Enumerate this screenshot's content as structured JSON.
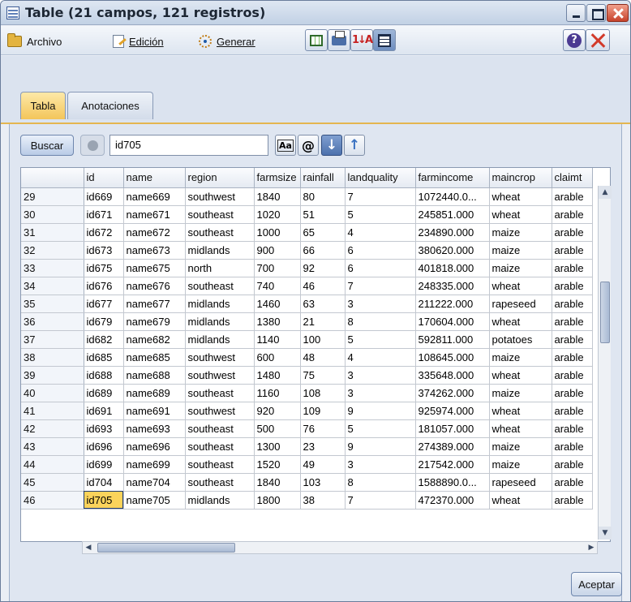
{
  "window": {
    "title": "Table (21 campos, 121 registros)"
  },
  "menu": {
    "file": "Archivo",
    "edit": "Edición",
    "generate": "Generar"
  },
  "tabs": [
    {
      "label": "Tabla",
      "active": true
    },
    {
      "label": "Anotaciones",
      "active": false
    }
  ],
  "search": {
    "button_label": "Buscar",
    "value": "id705"
  },
  "toolbar": {
    "icons": [
      "table-output-icon",
      "print-icon",
      "sort-icon",
      "grid-view-icon",
      "help-icon",
      "close-icon"
    ]
  },
  "grid": {
    "columns": [
      "",
      "id",
      "name",
      "region",
      "farmsize",
      "rainfall",
      "landquality",
      "farmincome",
      "maincrop",
      "claimt"
    ],
    "rows": [
      [
        "29",
        "id669",
        "name669",
        "southwest",
        "1840",
        "80",
        "7",
        "1072440.0...",
        "wheat",
        "arable"
      ],
      [
        "30",
        "id671",
        "name671",
        "southeast",
        "1020",
        "51",
        "5",
        "245851.000",
        "wheat",
        "arable"
      ],
      [
        "31",
        "id672",
        "name672",
        "southeast",
        "1000",
        "65",
        "4",
        "234890.000",
        "maize",
        "arable"
      ],
      [
        "32",
        "id673",
        "name673",
        "midlands",
        "900",
        "66",
        "6",
        "380620.000",
        "maize",
        "arable"
      ],
      [
        "33",
        "id675",
        "name675",
        "north",
        "700",
        "92",
        "6",
        "401818.000",
        "maize",
        "arable"
      ],
      [
        "34",
        "id676",
        "name676",
        "southeast",
        "740",
        "46",
        "7",
        "248335.000",
        "wheat",
        "arable"
      ],
      [
        "35",
        "id677",
        "name677",
        "midlands",
        "1460",
        "63",
        "3",
        "211222.000",
        "rapeseed",
        "arable"
      ],
      [
        "36",
        "id679",
        "name679",
        "midlands",
        "1380",
        "21",
        "8",
        "170604.000",
        "wheat",
        "arable"
      ],
      [
        "37",
        "id682",
        "name682",
        "midlands",
        "1140",
        "100",
        "5",
        "592811.000",
        "potatoes",
        "arable"
      ],
      [
        "38",
        "id685",
        "name685",
        "southwest",
        "600",
        "48",
        "4",
        "108645.000",
        "maize",
        "arable"
      ],
      [
        "39",
        "id688",
        "name688",
        "southwest",
        "1480",
        "75",
        "3",
        "335648.000",
        "wheat",
        "arable"
      ],
      [
        "40",
        "id689",
        "name689",
        "southeast",
        "1160",
        "108",
        "3",
        "374262.000",
        "maize",
        "arable"
      ],
      [
        "41",
        "id691",
        "name691",
        "southwest",
        "920",
        "109",
        "9",
        "925974.000",
        "wheat",
        "arable"
      ],
      [
        "42",
        "id693",
        "name693",
        "southeast",
        "500",
        "76",
        "5",
        "181057.000",
        "wheat",
        "arable"
      ],
      [
        "43",
        "id696",
        "name696",
        "southeast",
        "1300",
        "23",
        "9",
        "274389.000",
        "maize",
        "arable"
      ],
      [
        "44",
        "id699",
        "name699",
        "southeast",
        "1520",
        "49",
        "3",
        "217542.000",
        "maize",
        "arable"
      ],
      [
        "45",
        "id704",
        "name704",
        "southeast",
        "1840",
        "103",
        "8",
        "1588890.0...",
        "rapeseed",
        "arable"
      ],
      [
        "46",
        "id705",
        "name705",
        "midlands",
        "1800",
        "38",
        "7",
        "472370.000",
        "wheat",
        "arable"
      ]
    ],
    "selected_cell": {
      "row": 17,
      "col": 1
    },
    "selection_color": "#fbd35b"
  },
  "footer": {
    "ok_label": "Aceptar"
  }
}
